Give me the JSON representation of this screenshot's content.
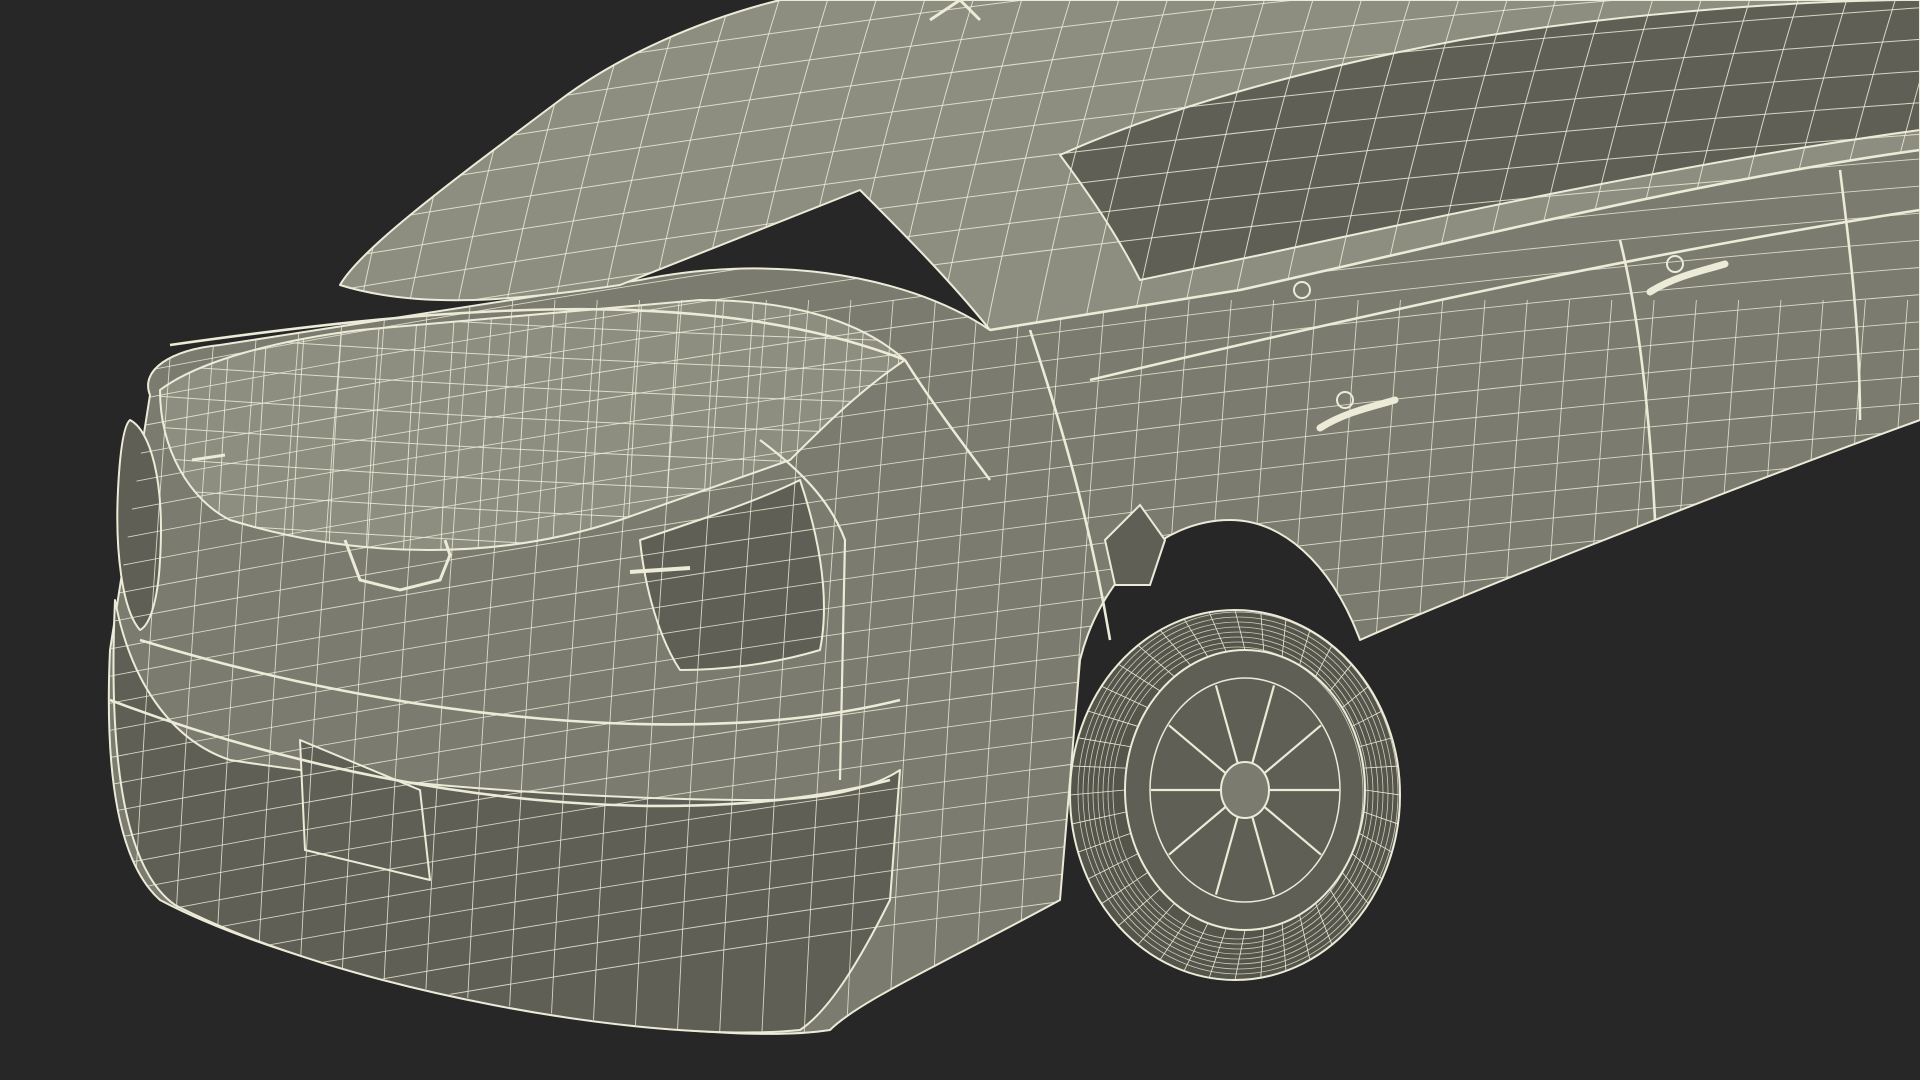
{
  "scene": {
    "subject": "wireframe-limousine-rear-three-quarter",
    "background_color": "#272727",
    "body_color": "#7b7b6f",
    "body_shadow_color": "#5f5f55",
    "body_highlight_color": "#8d8d80",
    "wire_color": "#ecebd8",
    "tire_color": "#55554c"
  }
}
